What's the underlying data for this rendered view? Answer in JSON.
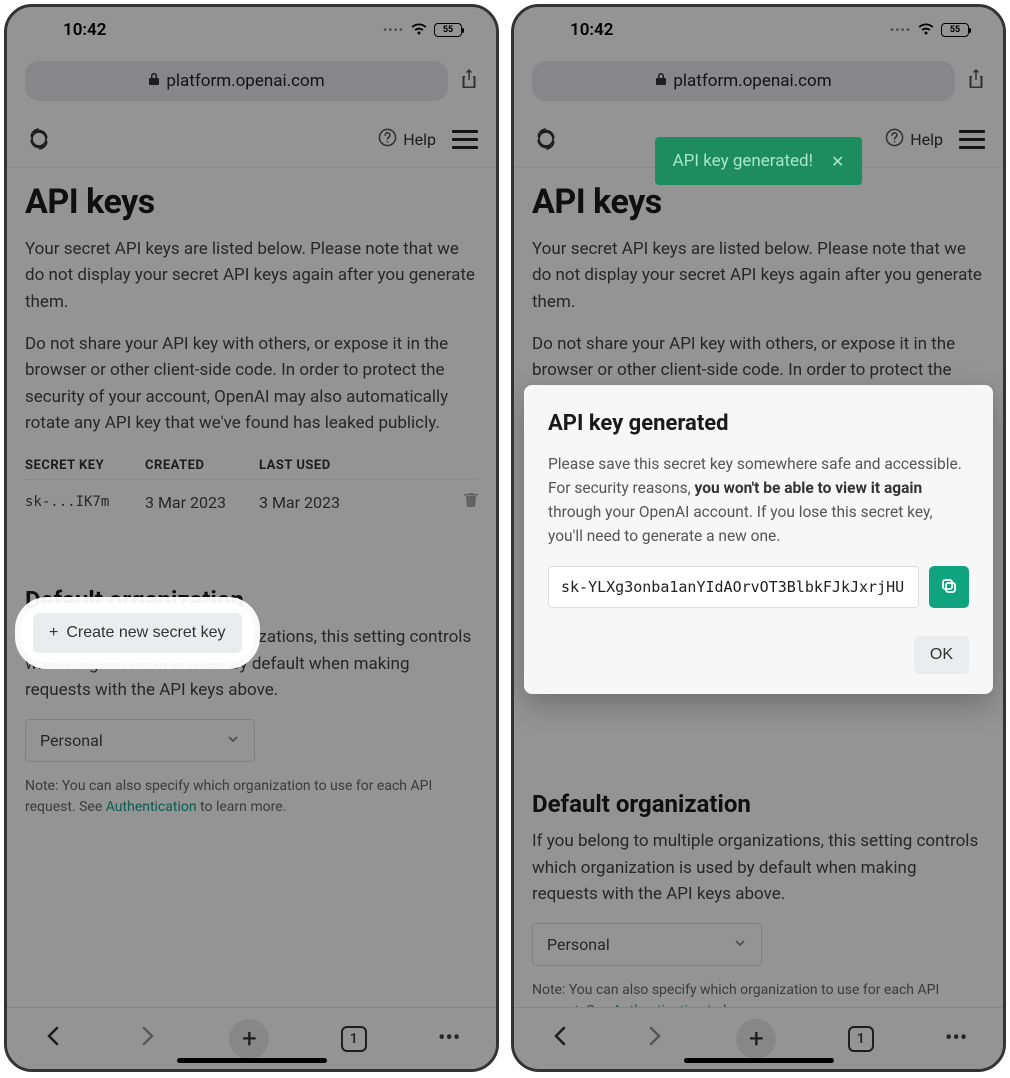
{
  "status": {
    "time": "10:42",
    "battery": "55"
  },
  "browser": {
    "url": "platform.openai.com",
    "tab_count": "1"
  },
  "header": {
    "help": "Help"
  },
  "page": {
    "title": "API keys",
    "intro1": "Your secret API keys are listed below. Please note that we do not display your secret API keys again after you generate them.",
    "intro2": "Do not share your API key with others, or expose it in the browser or other client-side code. In order to protect the security of your account, OpenAI may also automatically rotate any API key that we've found has leaked publicly.",
    "table": {
      "head_key": "SECRET KEY",
      "head_created": "CREATED",
      "head_used": "LAST USED",
      "rows": [
        {
          "key": "sk-...IK7m",
          "created": "3 Mar 2023",
          "used": "3 Mar 2023"
        }
      ]
    },
    "create_label": "Create new secret key",
    "org_heading": "Default organization",
    "org_text": "If you belong to multiple organizations, this setting controls which organization is used by default when making requests with the API keys above.",
    "org_selected": "Personal",
    "note_prefix": "Note: You can also specify which organization to use for each API request. See ",
    "note_link": "Authentication",
    "note_suffix": " to learn more."
  },
  "toast": {
    "text": "API key generated!"
  },
  "modal": {
    "title": "API key generated",
    "text1": "Please save this secret key somewhere safe and accessible. For security reasons, ",
    "bold": "you won't be able to view it again",
    "text2": " through your OpenAI account. If you lose this secret key, you'll need to generate a new one.",
    "key": "sk-YLXg3onba1anYIdAOrvOT3BlbkFJkJxrjHU",
    "ok": "OK"
  }
}
